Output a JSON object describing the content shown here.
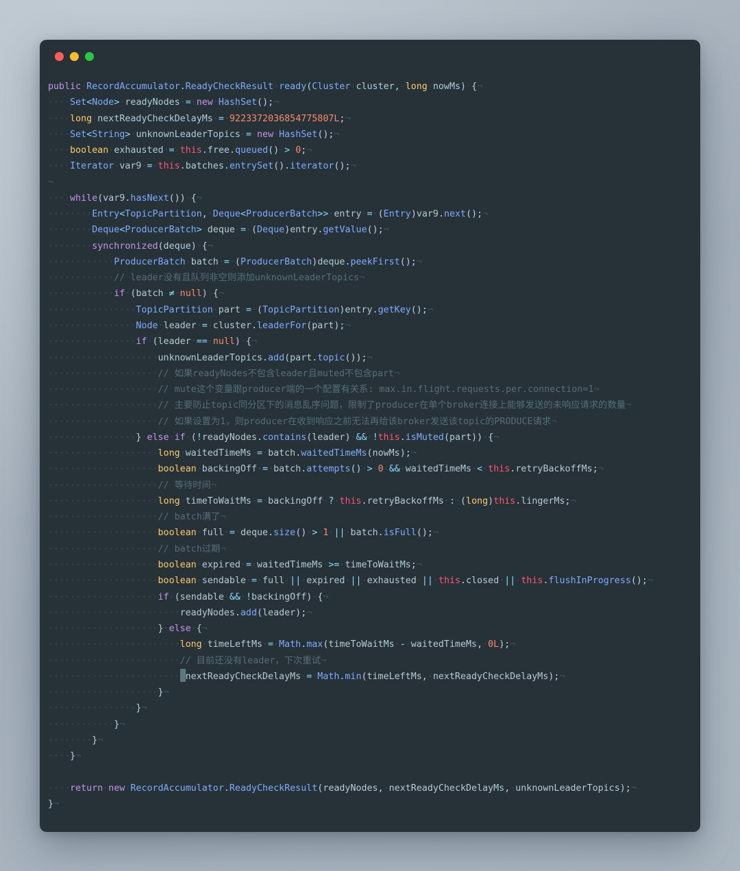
{
  "window": {
    "traffic_lights": [
      {
        "name": "close",
        "color": "#ff5f57"
      },
      {
        "name": "minimize",
        "color": "#febc2e"
      },
      {
        "name": "zoom",
        "color": "#28c840"
      }
    ]
  },
  "editor": {
    "language": "java",
    "theme_bg": "#263238",
    "colors": {
      "keyword": "#c792ea",
      "type": "#82aaff",
      "primitive": "#ffcb6b",
      "string_field": "#b2ccd6",
      "number": "#f78c6c",
      "operator": "#89ddff",
      "comment": "#546e7a",
      "this": "#ff5370",
      "cursor": "#5b7a80"
    },
    "lines": [
      "public RecordAccumulator.ReadyCheckResult ready(Cluster cluster, long nowMs) {",
      "    Set<Node> readyNodes = new HashSet();",
      "    long nextReadyCheckDelayMs = 9223372036854775807L;",
      "    Set<String> unknownLeaderTopics = new HashSet();",
      "    boolean exhausted = this.free.queued() > 0;",
      "    Iterator var9 = this.batches.entrySet().iterator();",
      "",
      "    while(var9.hasNext()) {",
      "        Entry<TopicPartition, Deque<ProducerBatch>> entry = (Entry)var9.next();",
      "        Deque<ProducerBatch> deque = (Deque)entry.getValue();",
      "        synchronized(deque) {",
      "            ProducerBatch batch = (ProducerBatch)deque.peekFirst();",
      "            // leader没有且队列非空则添加unknownLeaderTopics",
      "            if (batch != null) {",
      "                TopicPartition part = (TopicPartition)entry.getKey();",
      "                Node leader = cluster.leaderFor(part);",
      "                if (leader == null) {",
      "                    unknownLeaderTopics.add(part.topic());",
      "                    // 如果readyNodes不包含leader且muted不包含part",
      "                    // mute这个变量跟producer端的一个配置有关系: max.in.flight.requests.per.connection=1",
      "                    // 主要防止topic同分区下的消息乱序问题，限制了producer在单个broker连接上能够发送的未响应请求的数量",
      "                    // 如果设置为1，则producer在收到响应之前无法再给该broker发送该topic的PRODUCE请求",
      "                } else if (!readyNodes.contains(leader) && !this.isMuted(part)) {",
      "                    long waitedTimeMs = batch.waitedTimeMs(nowMs);",
      "                    boolean backingOff = batch.attempts() > 0 && waitedTimeMs < this.retryBackoffMs;",
      "                    // 等待时间",
      "                    long timeToWaitMs = backingOff ? this.retryBackoffMs : (long)this.lingerMs;",
      "                    // batch满了",
      "                    boolean full = deque.size() > 1 || batch.isFull();",
      "                    // batch过期",
      "                    boolean expired = waitedTimeMs >= timeToWaitMs;",
      "                    boolean sendable = full || expired || exhausted || this.closed || this.flushInProgress();",
      "                    if (sendable && !backingOff) {",
      "                        readyNodes.add(leader);",
      "                    } else {",
      "                        long timeLeftMs = Math.max(timeToWaitMs - waitedTimeMs, 0L);",
      "                        // 目前还没有leader，下次重试",
      "                        nextReadyCheckDelayMs = Math.min(timeLeftMs, nextReadyCheckDelayMs);",
      "                    }",
      "                }",
      "            }",
      "        }",
      "    }",
      "",
      "    return new RecordAccumulator.ReadyCheckResult(readyNodes, nextReadyCheckDelayMs, unknownLeaderTopics);",
      "}"
    ],
    "cursor_line_index": 37,
    "eol_marker": "¬",
    "space_marker": "·"
  }
}
